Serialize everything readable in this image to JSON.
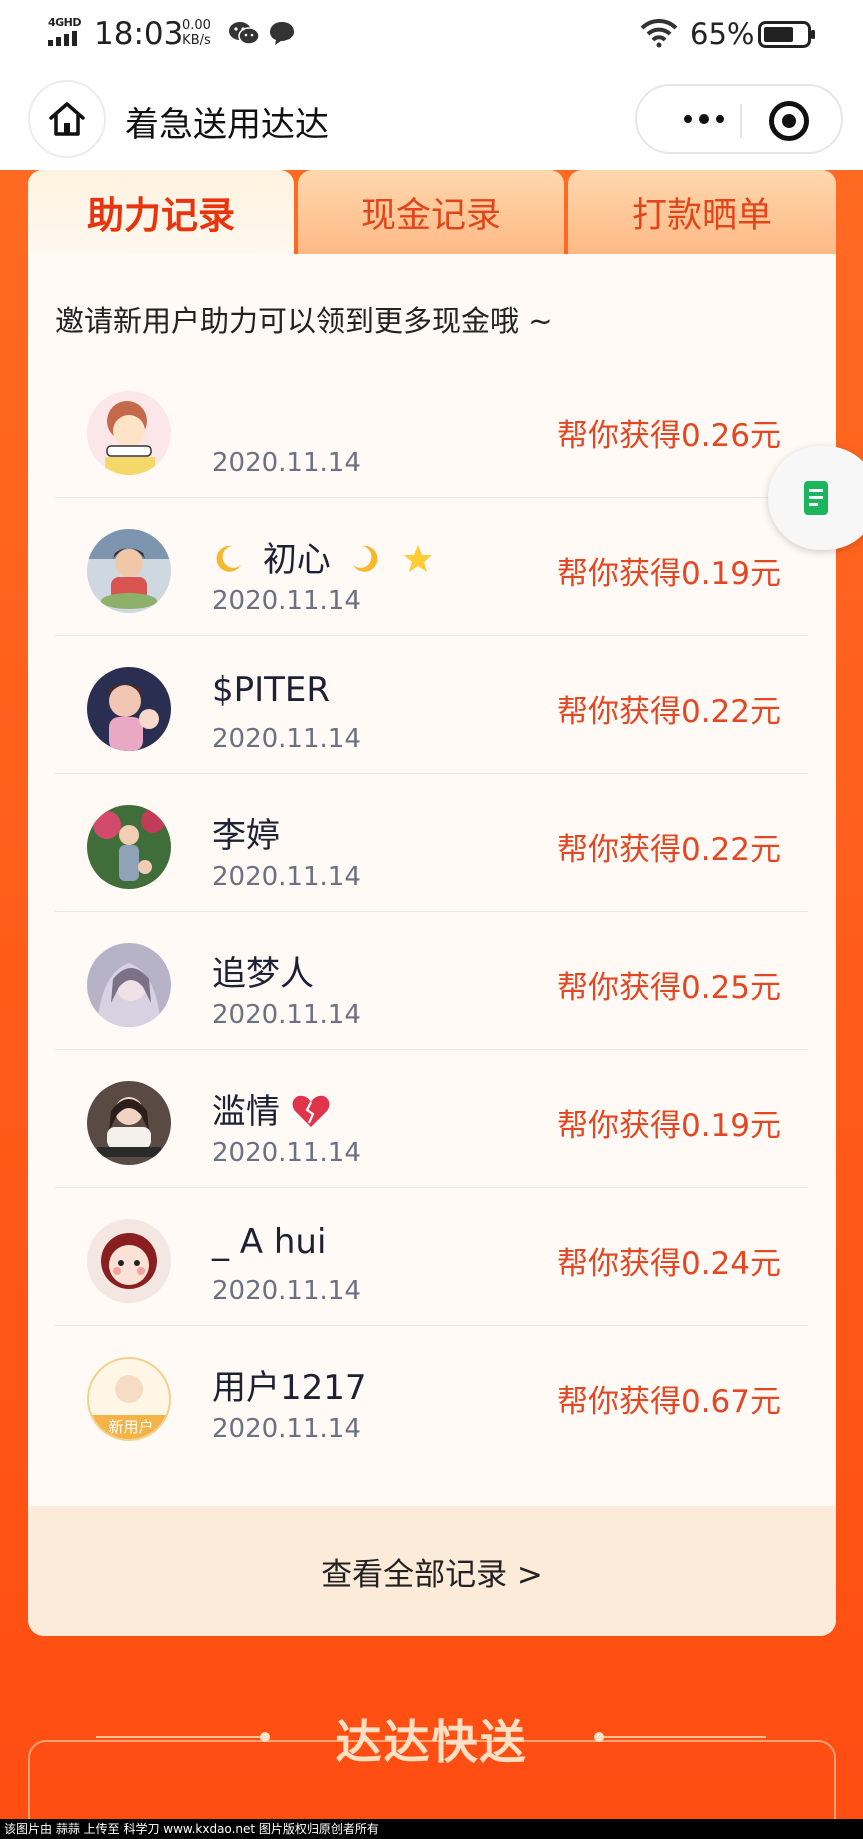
{
  "status_bar": {
    "network": "4GHD",
    "time": "18:03",
    "speed_value": "0.00",
    "speed_unit": "KB/s",
    "battery_pct": "65%"
  },
  "nav": {
    "title": "着急送用达达"
  },
  "tabs": [
    {
      "label": "助力记录",
      "active": true
    },
    {
      "label": "现金记录",
      "active": false
    },
    {
      "label": "打款晒单",
      "active": false
    }
  ],
  "hint": "邀请新用户助力可以领到更多现金哦 ~",
  "records": [
    {
      "name": "",
      "date": "2020.11.14",
      "amount": "帮你获得0.26元"
    },
    {
      "name": "初心",
      "date": "2020.11.14",
      "amount": "帮你获得0.19元"
    },
    {
      "name": "$PITER",
      "date": "2020.11.14",
      "amount": "帮你获得0.22元"
    },
    {
      "name": "李婷",
      "date": "2020.11.14",
      "amount": "帮你获得0.22元"
    },
    {
      "name": "追梦人",
      "date": "2020.11.14",
      "amount": "帮你获得0.25元"
    },
    {
      "name": "滥情",
      "date": "2020.11.14",
      "amount": "帮你获得0.19元"
    },
    {
      "name": "_ A hui",
      "date": "2020.11.14",
      "amount": "帮你获得0.24元"
    },
    {
      "name": "用户1217",
      "date": "2020.11.14",
      "amount": "帮你获得0.67元",
      "badge": "新用户"
    }
  ],
  "view_all": "查看全部记录 >",
  "section_title": "达达快送",
  "watermark": "该图片由 蒜蒜 上传至 科学刀 www.kxdao.net 图片版权归原创者所有",
  "colors": {
    "accent": "#e44722",
    "background": "#ff5a1a",
    "card": "#fffaf5"
  }
}
